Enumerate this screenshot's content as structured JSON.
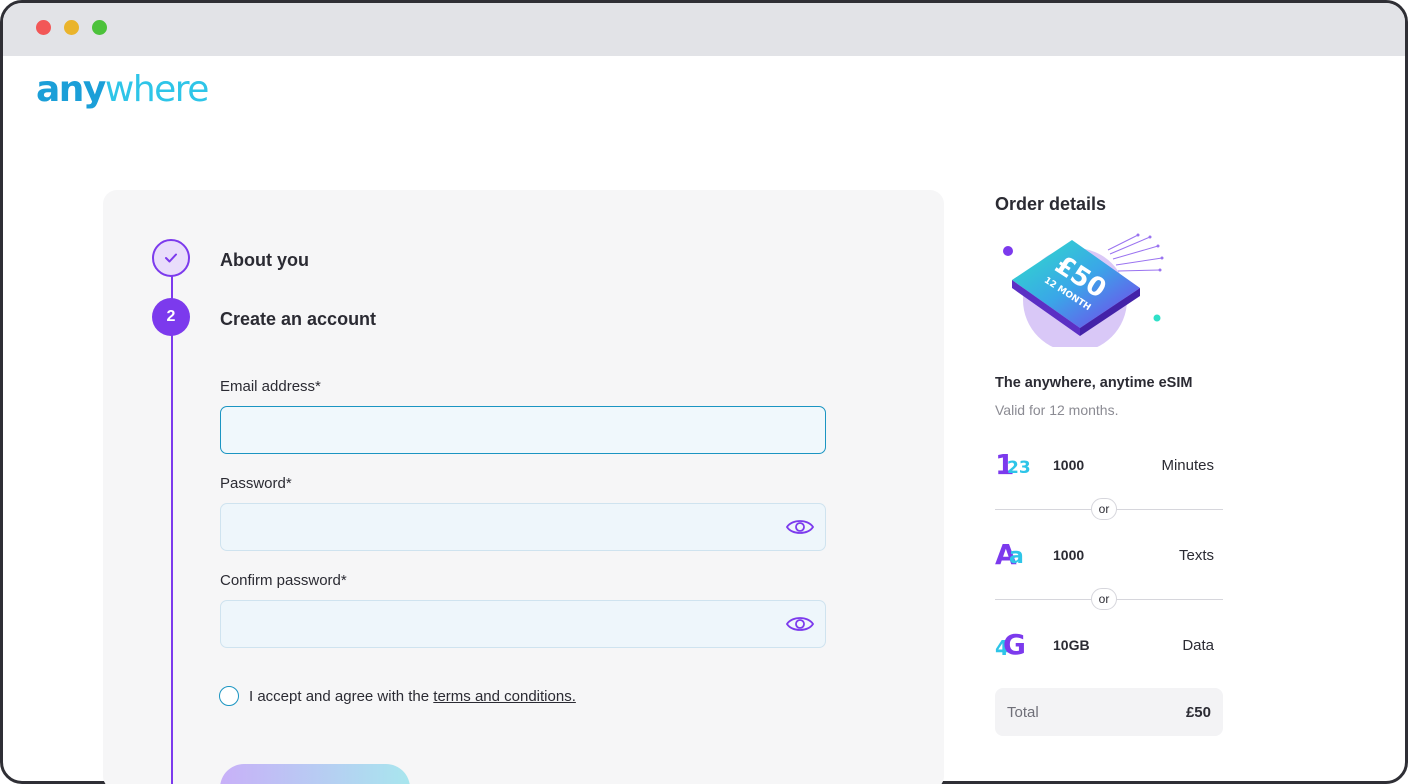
{
  "brand": {
    "logo_part1": "any",
    "logo_part2": "where"
  },
  "steps": [
    {
      "number": "",
      "label": "About you",
      "state": "done"
    },
    {
      "number": "2",
      "label": "Create an account",
      "state": "active"
    }
  ],
  "form": {
    "email_label": "Email address*",
    "email_value": "",
    "password_label": "Password*",
    "password_value": "",
    "confirm_label": "Confirm password*",
    "confirm_value": "",
    "accept_prefix": "I accept and agree with the ",
    "terms_link": "terms and conditions."
  },
  "order": {
    "title": "Order details",
    "badge_price": "£50",
    "badge_term": "12 MONTH",
    "plan_name": "The anywhere, anytime eSIM",
    "plan_valid": "Valid for 12 months.",
    "features": [
      {
        "icon": "numbers-icon",
        "icon_text_a": "1",
        "icon_text_b": "23",
        "amount": "1000",
        "unit": "Minutes"
      },
      {
        "icon": "letters-icon",
        "icon_text_a": "A",
        "icon_text_b": "a",
        "amount": "1000",
        "unit": "Texts"
      },
      {
        "icon": "4g-icon",
        "icon_text_a": "4",
        "icon_text_b": "G",
        "amount": "10GB",
        "unit": "Data"
      }
    ],
    "or_label": "or",
    "total_label": "Total",
    "total_value": "£50"
  },
  "colors": {
    "accent_purple": "#7c3aed",
    "accent_teal": "#2ec5e8",
    "logo_blue": "#1b9fd8",
    "field_border": "#1b95c2"
  }
}
